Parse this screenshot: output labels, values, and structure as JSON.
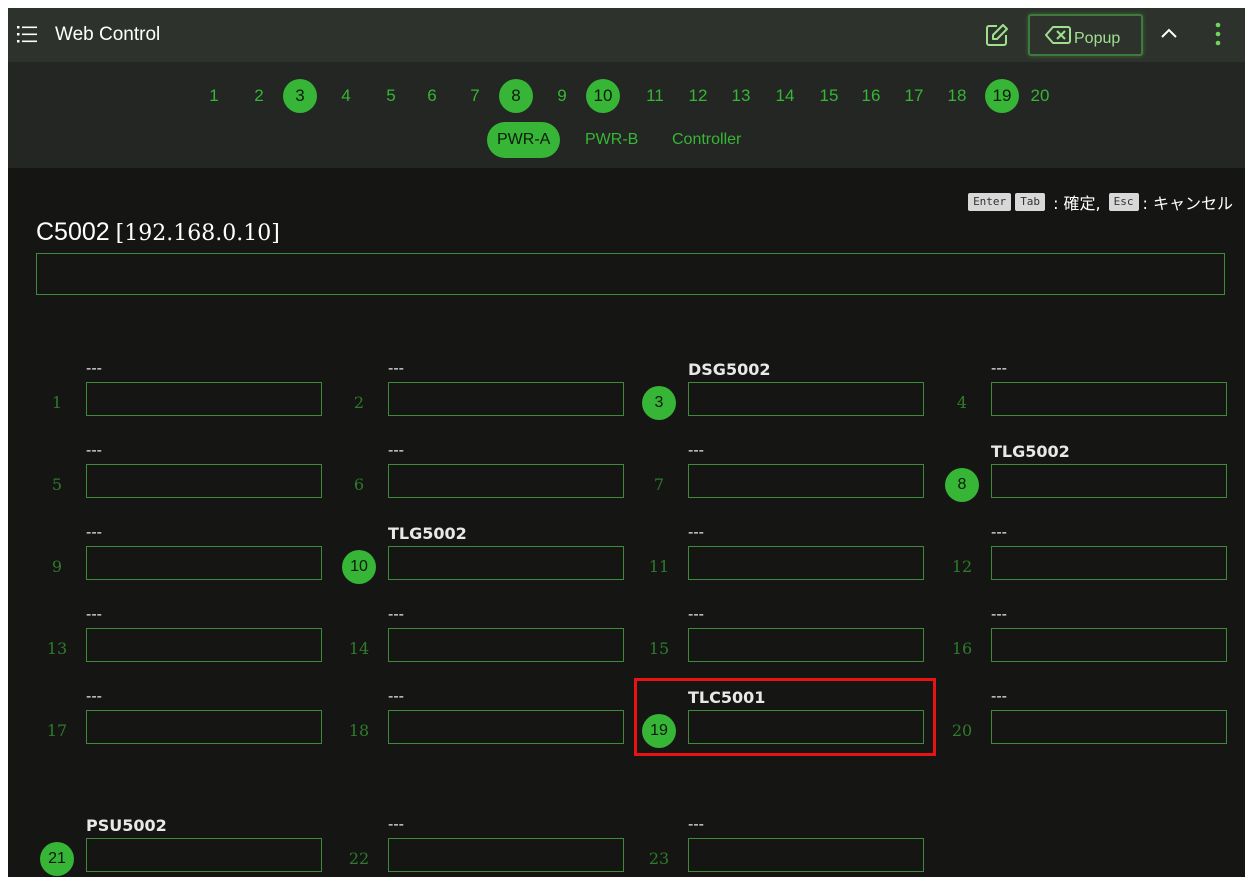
{
  "header": {
    "title": "Web Control",
    "menu_icon": "list-menu-icon",
    "edit_icon": "edit-icon",
    "popup_label": "Popup",
    "popup_icon": "backspace-icon",
    "collapse_icon": "chevron-up-icon",
    "more_icon": "more-vertical-icon"
  },
  "nav": {
    "numbers": [
      {
        "label": "1",
        "active": false
      },
      {
        "label": "2",
        "active": false
      },
      {
        "label": "3",
        "active": true
      },
      {
        "label": "4",
        "active": false
      },
      {
        "label": "5",
        "active": false
      },
      {
        "label": "6",
        "active": false
      },
      {
        "label": "7",
        "active": false
      },
      {
        "label": "8",
        "active": true
      },
      {
        "label": "9",
        "active": false
      },
      {
        "label": "10",
        "active": true
      },
      {
        "label": "11",
        "active": false
      },
      {
        "label": "12",
        "active": false
      },
      {
        "label": "13",
        "active": false
      },
      {
        "label": "14",
        "active": false
      },
      {
        "label": "15",
        "active": false
      },
      {
        "label": "16",
        "active": false
      },
      {
        "label": "17",
        "active": false
      },
      {
        "label": "18",
        "active": false
      },
      {
        "label": "19",
        "active": true
      },
      {
        "label": "20",
        "active": false
      }
    ],
    "modes": [
      {
        "label": "PWR-A",
        "active": true
      },
      {
        "label": "PWR-B",
        "active": false
      },
      {
        "label": "Controller",
        "active": false
      }
    ]
  },
  "hint": {
    "keys1": [
      "Enter",
      "Tab"
    ],
    "text1": ": 確定,",
    "key2": "Esc",
    "text2": ": キャンセル"
  },
  "device": {
    "name": "C5002",
    "ip": "[192.168.0.10]",
    "name_input_value": ""
  },
  "ports": [
    {
      "num": "1",
      "label": "---",
      "active": false
    },
    {
      "num": "2",
      "label": "---",
      "active": false
    },
    {
      "num": "3",
      "label": "DSG5002",
      "active": true
    },
    {
      "num": "4",
      "label": "---",
      "active": false
    },
    {
      "num": "5",
      "label": "---",
      "active": false
    },
    {
      "num": "6",
      "label": "---",
      "active": false
    },
    {
      "num": "7",
      "label": "---",
      "active": false
    },
    {
      "num": "8",
      "label": "TLG5002",
      "active": true
    },
    {
      "num": "9",
      "label": "---",
      "active": false
    },
    {
      "num": "10",
      "label": "TLG5002",
      "active": true
    },
    {
      "num": "11",
      "label": "---",
      "active": false
    },
    {
      "num": "12",
      "label": "---",
      "active": false
    },
    {
      "num": "13",
      "label": "---",
      "active": false
    },
    {
      "num": "14",
      "label": "---",
      "active": false
    },
    {
      "num": "15",
      "label": "---",
      "active": false
    },
    {
      "num": "16",
      "label": "---",
      "active": false
    },
    {
      "num": "17",
      "label": "---",
      "active": false
    },
    {
      "num": "18",
      "label": "---",
      "active": false
    },
    {
      "num": "19",
      "label": "TLC5001",
      "active": true
    },
    {
      "num": "20",
      "label": "---",
      "active": false
    },
    {
      "num": "21",
      "label": "PSU5002",
      "active": true
    },
    {
      "num": "22",
      "label": "---",
      "active": false
    },
    {
      "num": "23",
      "label": "---",
      "active": false
    }
  ],
  "colors": {
    "accent": "#37b536",
    "background": "#151614",
    "topbar": "#2e322d",
    "highlight": "#e81414"
  }
}
